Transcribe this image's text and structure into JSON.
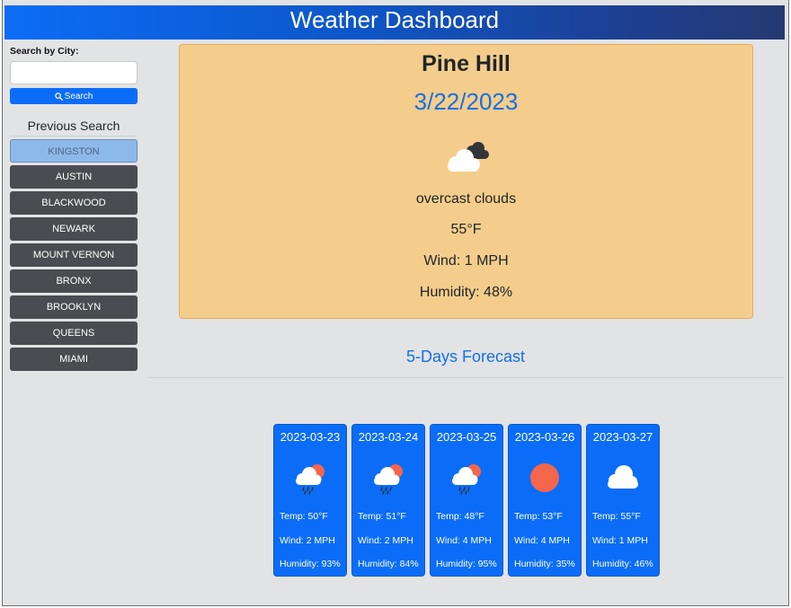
{
  "header": {
    "title": "Weather Dashboard"
  },
  "sidebar": {
    "search_label": "Search by City:",
    "search_placeholder": "",
    "search_button": "Search",
    "previous_title": "Previous Search",
    "cities": [
      "KINGSTON",
      "AUSTIN",
      "BLACKWOOD",
      "NEWARK",
      "MOUNT VERNON",
      "BRONX",
      "BROOKLYN",
      "QUEENS",
      "MIAMI"
    ]
  },
  "current": {
    "city": "Pine Hill",
    "date": "3/22/2023",
    "icon": "broken-clouds-icon",
    "description": "overcast clouds",
    "temp": "55°F",
    "wind": "Wind: 1 MPH",
    "humidity": "Humidity: 48%"
  },
  "forecast": {
    "title": "5-Days Forecast",
    "days": [
      {
        "date": "2023-03-23",
        "icon": "rain-sun-icon",
        "temp": "Temp: 50°F",
        "wind": "Wind: 2 MPH",
        "humidity": "Humidity: 93%"
      },
      {
        "date": "2023-03-24",
        "icon": "rain-sun-icon",
        "temp": "Temp: 51°F",
        "wind": "Wind: 2 MPH",
        "humidity": "Humidity: 84%"
      },
      {
        "date": "2023-03-25",
        "icon": "rain-sun-icon",
        "temp": "Temp: 48°F",
        "wind": "Wind: 4 MPH",
        "humidity": "Humidity: 95%"
      },
      {
        "date": "2023-03-26",
        "icon": "clear-sun-icon",
        "temp": "Temp: 53°F",
        "wind": "Wind: 4 MPH",
        "humidity": "Humidity: 35%"
      },
      {
        "date": "2023-03-27",
        "icon": "cloud-icon",
        "temp": "Temp: 55°F",
        "wind": "Wind: 1 MPH",
        "humidity": "Humidity: 46%"
      }
    ]
  },
  "colors": {
    "header_gradient_start": "#0b6df7",
    "header_gradient_end": "#253a72",
    "current_card_bg": "#f4cd8c",
    "forecast_card_bg": "#0b6df7",
    "city_button_bg": "#4a4c51",
    "accent_text": "#1470e6"
  }
}
